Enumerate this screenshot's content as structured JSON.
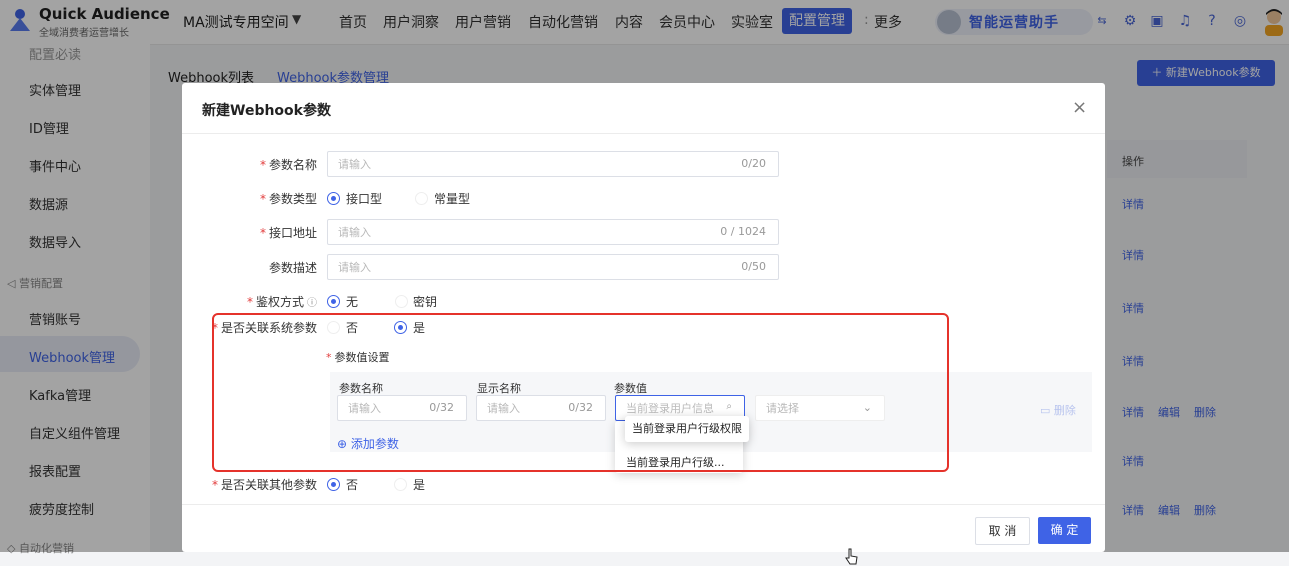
{
  "brand": {
    "title": "Quick Audience",
    "subtitle": "全域消费者运营增长"
  },
  "workspace": {
    "name": "MA测试专用空间"
  },
  "nav": {
    "items": [
      "首页",
      "用户洞察",
      "用户营销",
      "自动化营销",
      "内容",
      "会员中心",
      "实验室"
    ],
    "active": "配置管理",
    "more": "更多"
  },
  "assistant": {
    "label": "智能运营助手"
  },
  "sidebar": {
    "top_partial": "配置必读",
    "items_a": [
      "实体管理",
      "ID管理",
      "事件中心",
      "数据源",
      "数据导入"
    ],
    "group_marketing": "营销配置",
    "items_b": [
      "营销账号",
      "Webhook管理",
      "Kafka管理",
      "自定义组件管理",
      "报表配置",
      "疲劳度控制"
    ],
    "active": "Webhook管理",
    "group_auto": "自动化营销"
  },
  "page": {
    "tabs": [
      "Webhook列表",
      "Webhook参数管理"
    ],
    "active_tab": "Webhook参数管理",
    "new_button": "新建Webhook参数",
    "op_header": "操作",
    "op_detail": "详情",
    "op_edit": "编辑",
    "op_delete": "删除"
  },
  "modal": {
    "title": "新建Webhook参数",
    "fields": {
      "param_name": {
        "label": "参数名称",
        "placeholder": "请输入",
        "counter": "0/20"
      },
      "param_type": {
        "label": "参数类型",
        "options": [
          "接口型",
          "常量型"
        ],
        "selected": "接口型"
      },
      "api_url": {
        "label": "接口地址",
        "placeholder": "请输入",
        "counter": "0 / 1024"
      },
      "desc": {
        "label": "参数描述",
        "placeholder": "请输入",
        "counter": "0/50"
      },
      "auth": {
        "label": "鉴权方式",
        "options": [
          "无",
          "密钥"
        ],
        "selected": "无"
      },
      "link_system": {
        "label": "是否关联系统参数",
        "options": [
          "否",
          "是"
        ],
        "selected": "是"
      },
      "value_setting": {
        "label": "参数值设置",
        "col_name": "参数名称",
        "col_display": "显示名称",
        "col_value": "参数值",
        "row": {
          "name_placeholder": "请输入",
          "name_counter": "0/32",
          "display_placeholder": "请输入",
          "display_counter": "0/32",
          "value_text": "当前登录用户信息",
          "select_placeholder": "请选择",
          "delete": "删除"
        },
        "add": "添加参数"
      },
      "link_other": {
        "label": "是否关联其他参数",
        "options": [
          "否",
          "是"
        ],
        "selected": "否"
      }
    },
    "tooltip": "当前登录用户行级权限",
    "dropdown_item": "当前登录用户行级...",
    "cancel": "取 消",
    "ok": "确 定"
  }
}
